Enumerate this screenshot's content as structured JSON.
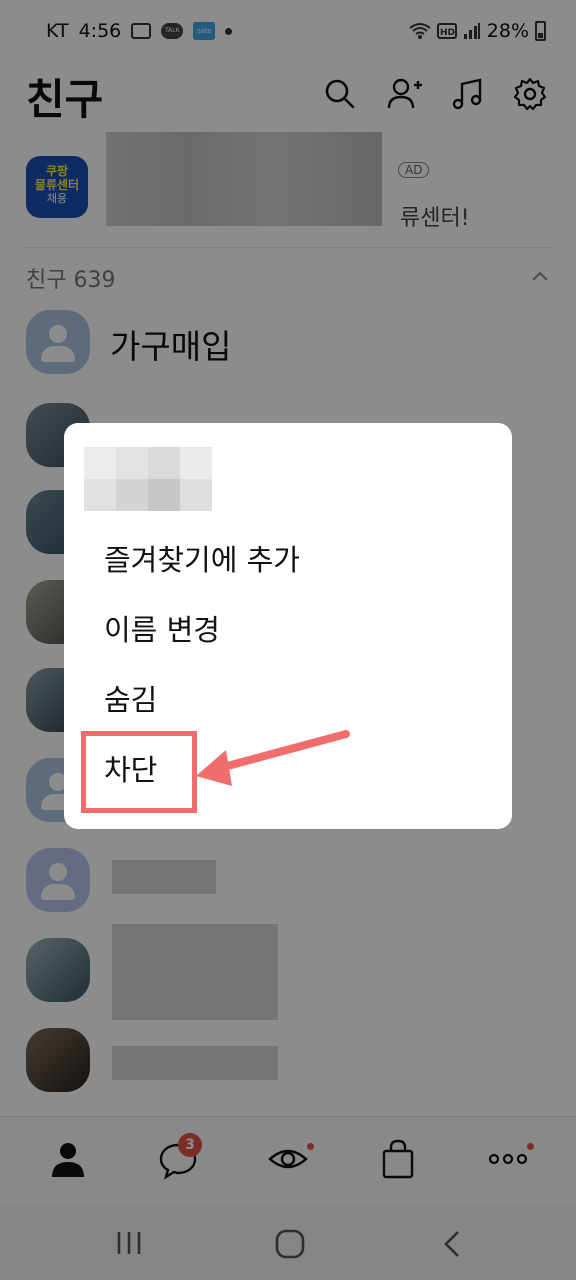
{
  "status_bar": {
    "carrier": "KT",
    "time": "4:56",
    "battery": "28%",
    "icons": [
      "gallery-icon",
      "talk-notification-icon",
      "sats-app-icon",
      "wifi-icon",
      "hd-voice-icon",
      "signal-icon",
      "battery-icon"
    ]
  },
  "header": {
    "title": "친구",
    "icons": [
      "search-icon",
      "add-friend-icon",
      "music-icon",
      "settings-icon"
    ]
  },
  "ad": {
    "logo_line1": "쿠팡",
    "logo_line2": "물류센터",
    "logo_line3": "채용",
    "badge": "AD",
    "text_fragment": "류센터!"
  },
  "friends_section": {
    "label": "친구 639"
  },
  "friends": [
    {
      "name": "가구매입"
    },
    {
      "name": ""
    },
    {
      "name": ""
    },
    {
      "name": ""
    },
    {
      "name": ""
    },
    {
      "name": ""
    },
    {
      "name": ""
    },
    {
      "name": ""
    },
    {
      "name": ""
    }
  ],
  "context_menu": {
    "items": [
      "즐겨찾기에 추가",
      "이름 변경",
      "숨김",
      "차단"
    ]
  },
  "bottom_nav": {
    "items": [
      "friends-tab",
      "chats-tab",
      "view-tab",
      "shopping-tab",
      "more-tab"
    ],
    "chat_badge": "3"
  },
  "colors": {
    "highlight": "#f06d6d",
    "badge": "#e25546"
  }
}
